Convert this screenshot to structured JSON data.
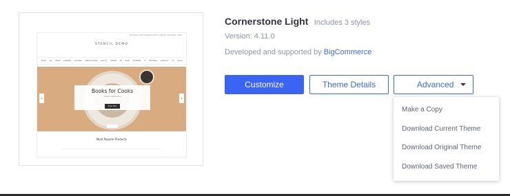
{
  "theme": {
    "name": "Cornerstone Light",
    "styles_note": "Includes 3 styles",
    "version": "Version: 4.11.0",
    "developer_prefix": "Developed and supported by ",
    "developer_link": "BigCommerce"
  },
  "preview": {
    "store_logo": "STENCIL DEMO",
    "top_nav": "WISHLIST  GIFT CERTIFICATES  CREATE ACCOUNT  CART",
    "main_nav": "SHOP ALL  BATH  GARDEN  KITCHEN  PUBLICATIONS  UTILITY  ORDER BY MAIL  SHIPPING & RETURNS  CONTACT US  BLOG",
    "hero_title": "Books for Cooks",
    "hero_subtitle": "Sample subtitle text",
    "hero_button": "Shop Now",
    "arrow_left": "‹",
    "arrow_right": "›",
    "section_title": "Most Popular Products"
  },
  "actions": {
    "customize_label": "Customize",
    "theme_details_label": "Theme Details",
    "advanced_label": "Advanced"
  },
  "advanced_menu": {
    "items": [
      {
        "label": "Make a Copy"
      },
      {
        "label": "Download Current Theme"
      },
      {
        "label": "Download Original Theme"
      },
      {
        "label": "Download Saved Theme"
      }
    ]
  },
  "icons": {
    "advanced_caret": "caret-down-icon"
  },
  "colors": {
    "accent": "#3c64f4",
    "text_primary": "#313440",
    "text_muted": "#8c93ad",
    "hero_bg": "#d9ab80"
  }
}
